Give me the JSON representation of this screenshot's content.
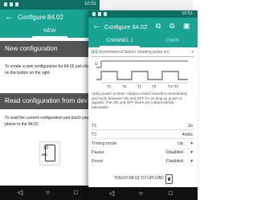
{
  "back_screen": {
    "status_time": "10:51",
    "title": "Configure 84.02",
    "tab": "NEW",
    "new_config": {
      "heading": "New configuration",
      "text": "To create a new configuration for 84.02 just click on the button on the right."
    },
    "read_config": {
      "heading": "Read configuration from dev",
      "text": "To read the current configuration just touch your phone to the 84.02."
    },
    "nfc_label": "NFC"
  },
  "front_screen": {
    "status_time": "10:51",
    "title": "Configure 84.02",
    "tabs": [
      "CHANNEL 1",
      "CHAN"
    ],
    "function_code": "(LI)",
    "function_name": "Asymmetrical flasher (starting pulse on)",
    "description": "Apply power to timer. Output contact transfers immediately and cycle between ON and OFF for as long as power is applied. The ON and OFF times are independently adjustable.",
    "diagram_labels": {
      "u": "U",
      "t1": "T1",
      "t2": "T2",
      "t1t2": "T1+T2"
    },
    "rows": [
      {
        "label": "T1",
        "value": "3s"
      },
      {
        "label": "T2",
        "value": "4m6s"
      },
      {
        "label": "Timing mode",
        "value": "Up"
      },
      {
        "label": "Pause",
        "value": "Disabled"
      },
      {
        "label": "Reset",
        "value": "Disabled"
      }
    ],
    "upload_label": "TOUCH 84.02 TO UPLOAD"
  },
  "colors": {
    "appbar": "#18a392",
    "statusbar": "#0e6f62",
    "section_head": "#555555",
    "nav": "#111111"
  }
}
